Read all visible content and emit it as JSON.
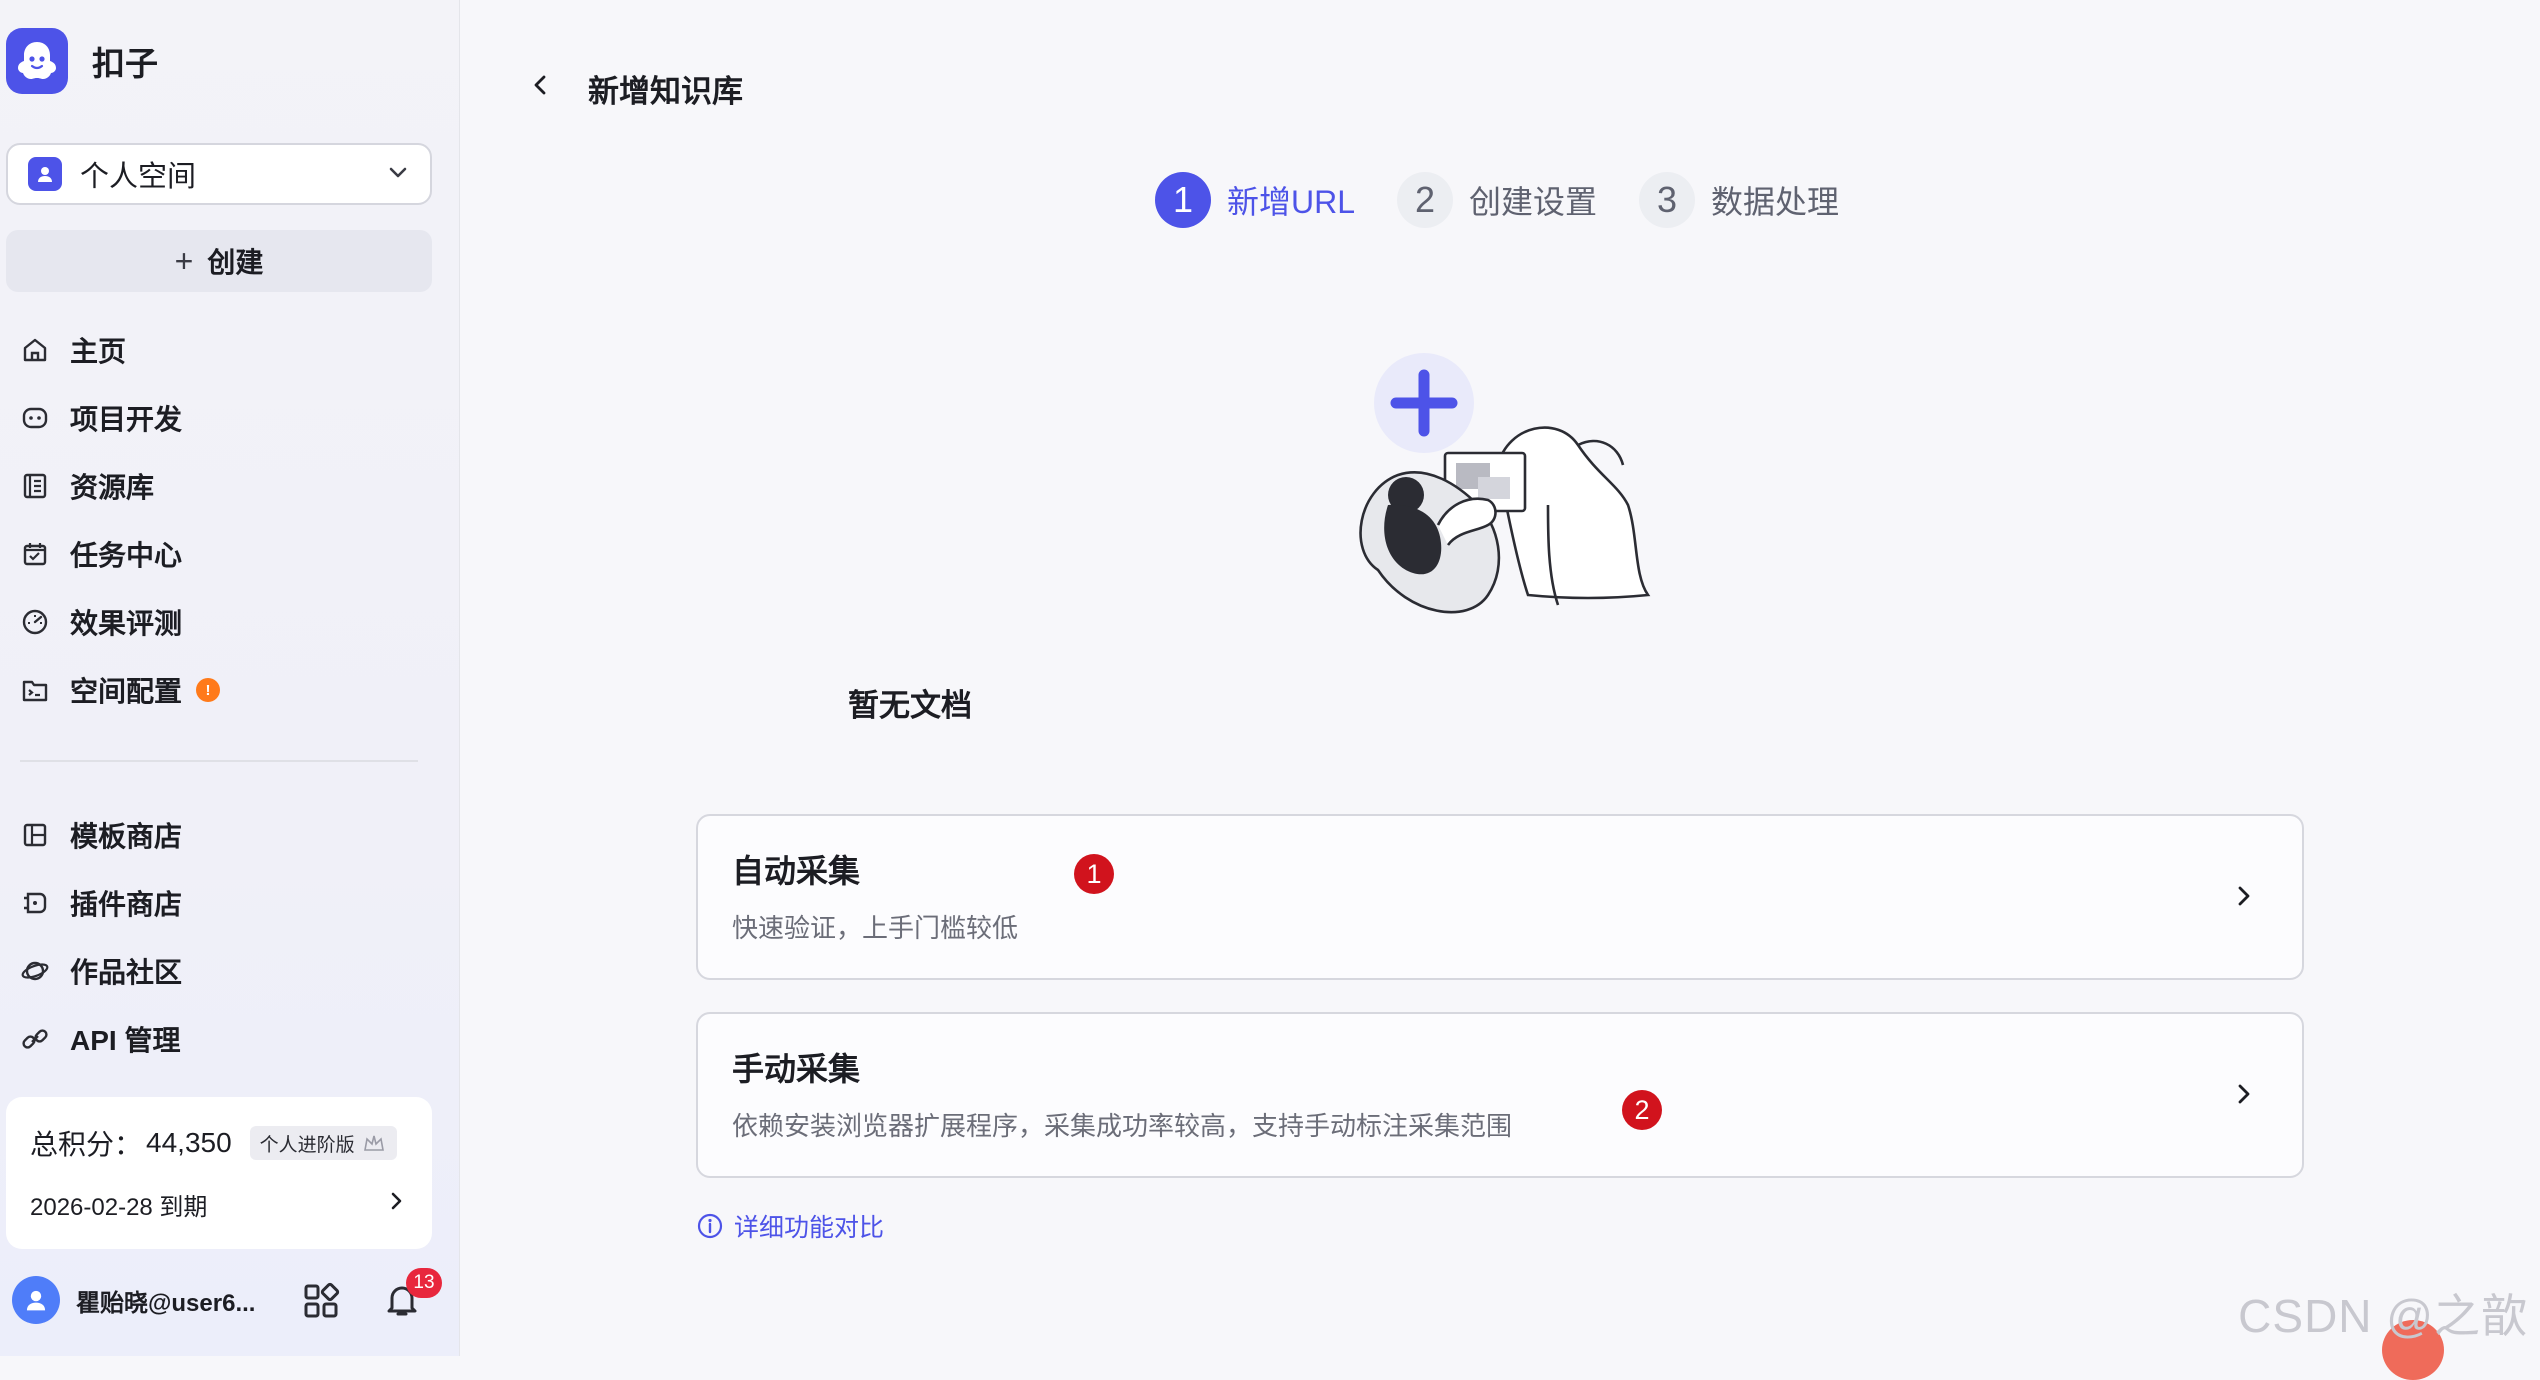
{
  "app": {
    "name": "扣子"
  },
  "sidebar": {
    "space": {
      "label": "个人空间"
    },
    "create_label": "创建",
    "nav": [
      {
        "label": "主页",
        "icon": "home-icon"
      },
      {
        "label": "项目开发",
        "icon": "bot-icon"
      },
      {
        "label": "资源库",
        "icon": "library-icon"
      },
      {
        "label": "任务中心",
        "icon": "task-icon"
      },
      {
        "label": "效果评测",
        "icon": "gauge-icon"
      },
      {
        "label": "空间配置",
        "icon": "terminal-folder-icon",
        "badge": "!"
      }
    ],
    "nav2": [
      {
        "label": "模板商店",
        "icon": "template-icon"
      },
      {
        "label": "插件商店",
        "icon": "plugin-icon"
      },
      {
        "label": "作品社区",
        "icon": "planet-icon"
      },
      {
        "label": "API 管理",
        "icon": "api-link-icon"
      }
    ],
    "points": {
      "label": "总积分：",
      "value": "44,350",
      "tier": "个人进阶版",
      "expiry": "2026-02-28 到期"
    },
    "user": {
      "name": "瞿贻晓@user6...",
      "notifications": "13"
    }
  },
  "main": {
    "title": "新增知识库",
    "steps": [
      {
        "num": "1",
        "label": "新增URL",
        "active": true
      },
      {
        "num": "2",
        "label": "创建设置",
        "active": false
      },
      {
        "num": "3",
        "label": "数据处理",
        "active": false
      }
    ],
    "empty_text": "暂无文档",
    "options": [
      {
        "title": "自动采集",
        "desc": "快速验证，上手门槛较低",
        "marker": "1"
      },
      {
        "title": "手动采集",
        "desc": "依赖安装浏览器扩展程序，采集成功率较高，支持手动标注采集范围",
        "marker": "2"
      }
    ],
    "compare_link": "详细功能对比",
    "accent_color": "#4d53e8"
  },
  "watermark": "CSDN @之歆"
}
